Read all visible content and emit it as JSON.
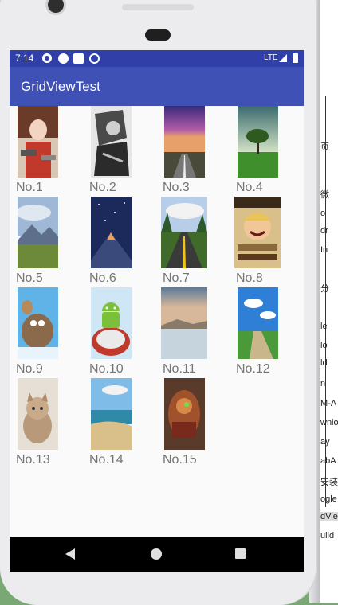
{
  "status_bar": {
    "time": "7:14",
    "network": "LTE"
  },
  "app_bar": {
    "title": "GridViewTest"
  },
  "grid_items": [
    {
      "label": "No.1",
      "image": "anime-girl-gunner"
    },
    {
      "label": "No.2",
      "image": "anime-sketch-soldier"
    },
    {
      "label": "No.3",
      "image": "purple-sky-road"
    },
    {
      "label": "No.4",
      "image": "lone-tree-field"
    },
    {
      "label": "No.5",
      "image": "mountain-meadow"
    },
    {
      "label": "No.6",
      "image": "starry-peak"
    },
    {
      "label": "No.7",
      "image": "forest-road"
    },
    {
      "label": "No.8",
      "image": "luffy-wanted-poster"
    },
    {
      "label": "No.9",
      "image": "ice-age-characters"
    },
    {
      "label": "No.10",
      "image": "android-robot-cake"
    },
    {
      "label": "No.11",
      "image": "frozen-lake-sunset"
    },
    {
      "label": "No.12",
      "image": "blue-sky-path"
    },
    {
      "label": "No.13",
      "image": "fluffy-kitten"
    },
    {
      "label": "No.14",
      "image": "sunny-beach"
    },
    {
      "label": "No.15",
      "image": "armored-warrior-art"
    }
  ],
  "nav_bar": {
    "back_icon": "back-triangle-icon",
    "home_icon": "home-circle-icon",
    "recents_icon": "recents-square-icon"
  },
  "background_window": {
    "lines": [
      "页",
      "微",
      "o",
      "dr",
      "In",
      "分",
      "le",
      "lo",
      "ld",
      "n",
      "M-A",
      "wnlo",
      "ay",
      "abA",
      "安装",
      "ogle",
      "dVie",
      "uild"
    ]
  },
  "colors": {
    "status_bar": "#3140a8",
    "app_bar": "#3f51b5",
    "screen_bg": "#fafafa",
    "label_text": "#757575"
  }
}
